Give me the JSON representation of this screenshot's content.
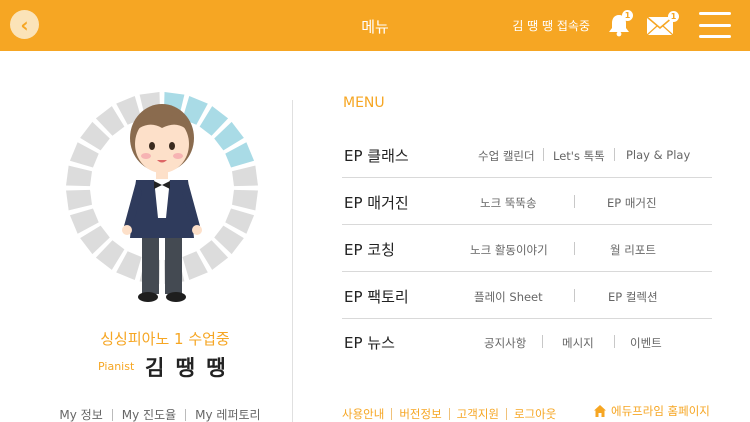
{
  "header": {
    "back_icon": "back-chevron-icon",
    "title": "메뉴",
    "user_status": "김 땡 땡  접속중",
    "notification_badge": "1",
    "mail_badge": "1",
    "accent_color": "#f6a623"
  },
  "profile": {
    "progress_filled_segments": 5,
    "progress_total_segments": 24,
    "status": "싱싱피아노 1 수업중",
    "role": "Pianist",
    "name": "김 땡 땡",
    "links": [
      "My 정보",
      "My 진도율",
      "My 레퍼토리"
    ]
  },
  "menu": {
    "heading": "MENU",
    "rows": [
      {
        "title": "EP 클래스",
        "items": [
          "수업 캘린더",
          "Let's 톡톡",
          "Play & Play"
        ]
      },
      {
        "title": "EP 매거진",
        "items": [
          "노크 뚝뚝송",
          "EP 매거진"
        ]
      },
      {
        "title": "EP 코칭",
        "items": [
          "노크 활동이야기",
          "월 리포트"
        ]
      },
      {
        "title": "EP 팩토리",
        "items": [
          "플레이 Sheet",
          "EP 컬렉션"
        ]
      },
      {
        "title": "EP 뉴스",
        "items": [
          "공지사항",
          "메시지",
          "이벤트"
        ]
      }
    ]
  },
  "footer": {
    "links": [
      "사용안내",
      "버전정보",
      "고객지원",
      "로그아웃"
    ],
    "home_link": "에듀프라임 홈페이지"
  }
}
